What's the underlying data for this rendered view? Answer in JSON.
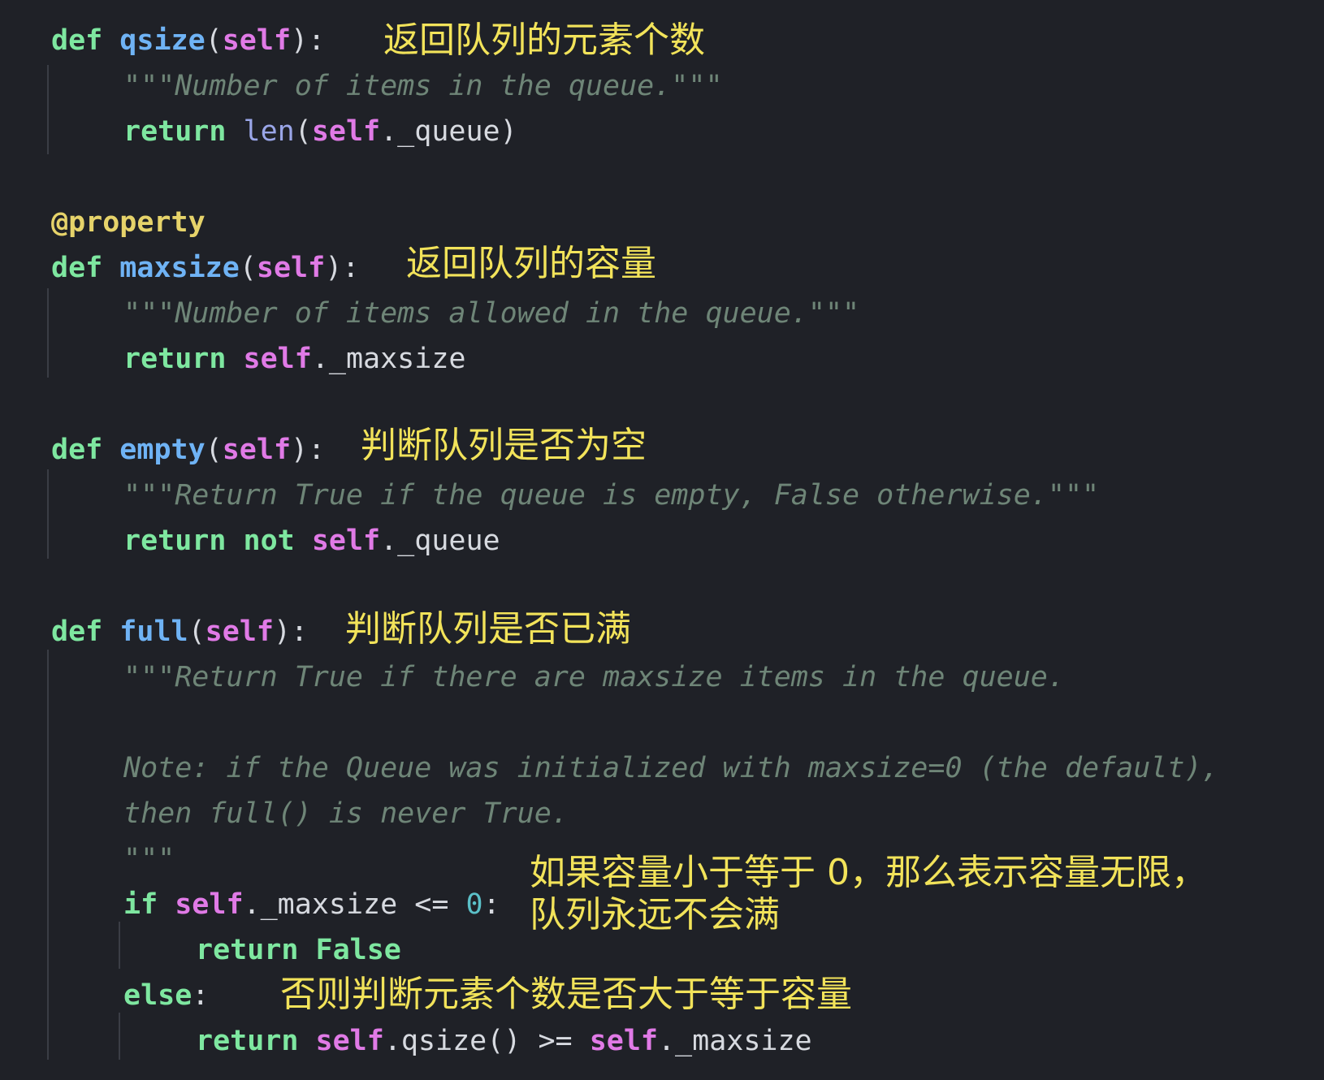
{
  "code": {
    "def_kw": "def",
    "return_kw": "return",
    "self_kw": "self",
    "fn_qsize": "qsize",
    "fn_maxsize": "maxsize",
    "fn_empty": "empty",
    "fn_full": "full",
    "decorator": "@property",
    "doc_qsize": "\"\"\"Number of items in the queue.\"\"\"",
    "doc_maxsize": "\"\"\"Number of items allowed in the queue.\"\"\"",
    "doc_empty": "\"\"\"Return True if the queue is empty, False otherwise.\"\"\"",
    "doc_full_1": "\"\"\"Return True if there are maxsize items in the queue.",
    "doc_full_2": "Note: if the Queue was initialized with maxsize=0 (the default),",
    "doc_full_3": "then full() is never True.",
    "doc_full_4": "\"\"\"",
    "len_fn": "len",
    "attr_queue": "._queue",
    "attr_maxsize": "._maxsize",
    "not_kw": "not",
    "if_kw": "if",
    "else_kw": "else",
    "false_kw": "False",
    "lte_op": " <= ",
    "zero": "0",
    "gte_op": " >= ",
    "qsize_call": ".qsize()"
  },
  "annotations": {
    "qsize": "返回队列的元素个数",
    "maxsize": "返回队列的容量",
    "empty": "判断队列是否为空",
    "full": "判断队列是否已满",
    "if_line1": "如果容量小于等于 0，那么表示容量无限，",
    "if_line2": "队列永远不会满",
    "else": "否则判断元素个数是否大于等于容量"
  }
}
